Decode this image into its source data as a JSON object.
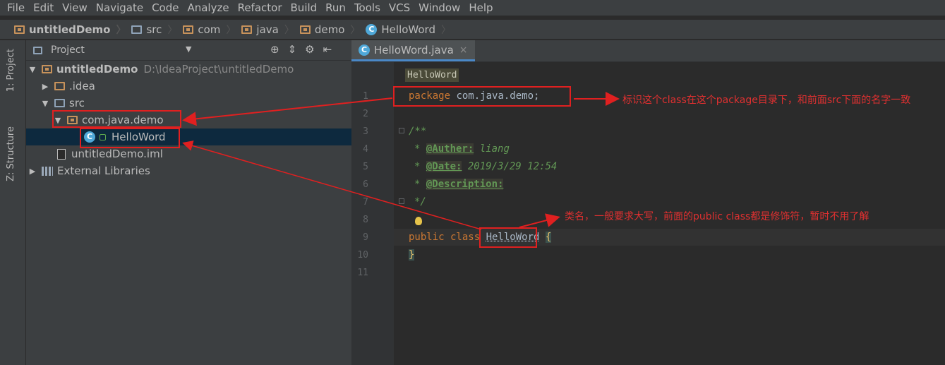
{
  "menu": [
    "File",
    "Edit",
    "View",
    "Navigate",
    "Code",
    "Analyze",
    "Refactor",
    "Build",
    "Run",
    "Tools",
    "VCS",
    "Window",
    "Help"
  ],
  "breadcrumbs": [
    "untitledDemo",
    "src",
    "com",
    "java",
    "demo",
    "HelloWord"
  ],
  "toolstrip": {
    "project_tab": "1: Project",
    "structure_tab": "Z: Structure"
  },
  "project_panel": {
    "title": "Project",
    "tree": [
      {
        "label": "untitledDemo",
        "detail": "D:\\IdeaProject\\untitledDemo"
      },
      {
        "label": ".idea"
      },
      {
        "label": "src"
      },
      {
        "label": "com.java.demo"
      },
      {
        "label": "HelloWord"
      },
      {
        "label": "untitledDemo.iml"
      },
      {
        "label": "External Libraries"
      }
    ]
  },
  "editor": {
    "tab_label": "HelloWord.java",
    "breadcrumb": "HelloWord",
    "line_numbers": [
      "1",
      "2",
      "3",
      "4",
      "5",
      "6",
      "7",
      "8",
      "9",
      "10",
      "11"
    ],
    "code": {
      "package_kw": "package",
      "package_name": " com.java.demo;",
      "doc_open": "/**",
      "author_tag": "@Auther:",
      "author_val": " liang",
      "date_tag": "@Date:",
      "date_val": " 2019/3/29 12:54",
      "desc_tag": "@Description:",
      "doc_close": "*/",
      "public_kw": "public class ",
      "class_name": "HelloWord",
      "open_brace": "{",
      "close_brace": "}"
    }
  },
  "annotations": {
    "package_note": "标识这个class在这个package目录下，和前面src下面的名字一致",
    "class_note": "类名，一般要求大写，前面的public class都是修饰符，暂时不用了解"
  },
  "colors": {
    "annotation": "#e02020",
    "keyword": "#cc7832",
    "doc": "#629755"
  }
}
